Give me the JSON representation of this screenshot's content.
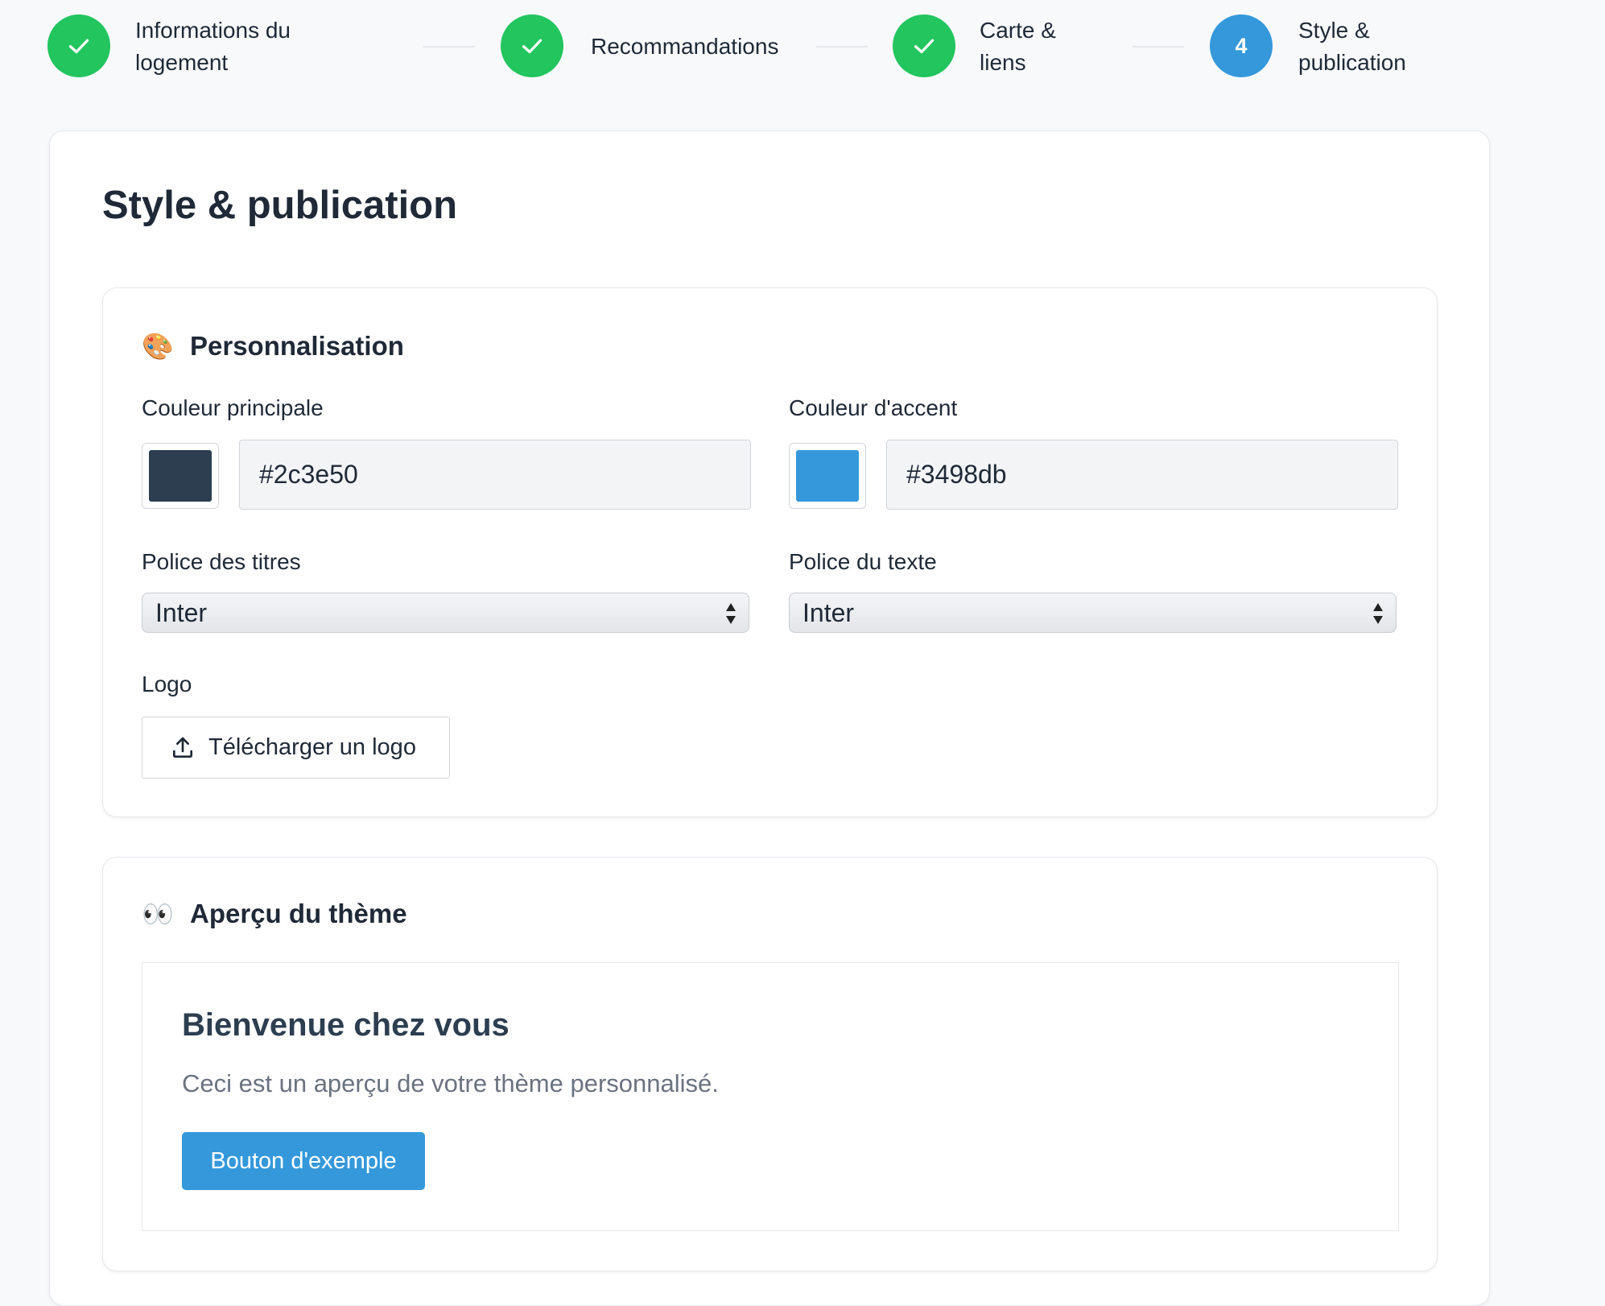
{
  "stepper": {
    "steps": [
      {
        "label_line1": "Informations du",
        "label_line2": "logement",
        "status": "done"
      },
      {
        "label_line1": "Recommandations",
        "label_line2": "",
        "status": "done"
      },
      {
        "label_line1": "Carte &",
        "label_line2": "liens",
        "status": "done"
      },
      {
        "number": "4",
        "label_line1": "Style &",
        "label_line2": "publication",
        "status": "active"
      }
    ],
    "done_icon": "check-icon"
  },
  "page": {
    "title": "Style & publication"
  },
  "personalisation": {
    "emoji": "🎨",
    "title": "Personnalisation",
    "primary_color": {
      "label": "Couleur principale",
      "value": "#2c3e50"
    },
    "accent_color": {
      "label": "Couleur d'accent",
      "value": "#3498db"
    },
    "title_font": {
      "label": "Police des titres",
      "selected": "Inter"
    },
    "text_font": {
      "label": "Police du texte",
      "selected": "Inter"
    },
    "logo": {
      "label": "Logo",
      "button_label": "Télécharger un logo",
      "icon": "upload-icon"
    }
  },
  "preview": {
    "emoji": "👀",
    "title": "Aperçu du thème",
    "heading": "Bienvenue chez vous",
    "text": "Ceci est un aperçu de votre thème personnalisé.",
    "button_label": "Bouton d'exemple"
  },
  "colors": {
    "success": "#22c55e",
    "active_step": "#3498db"
  }
}
